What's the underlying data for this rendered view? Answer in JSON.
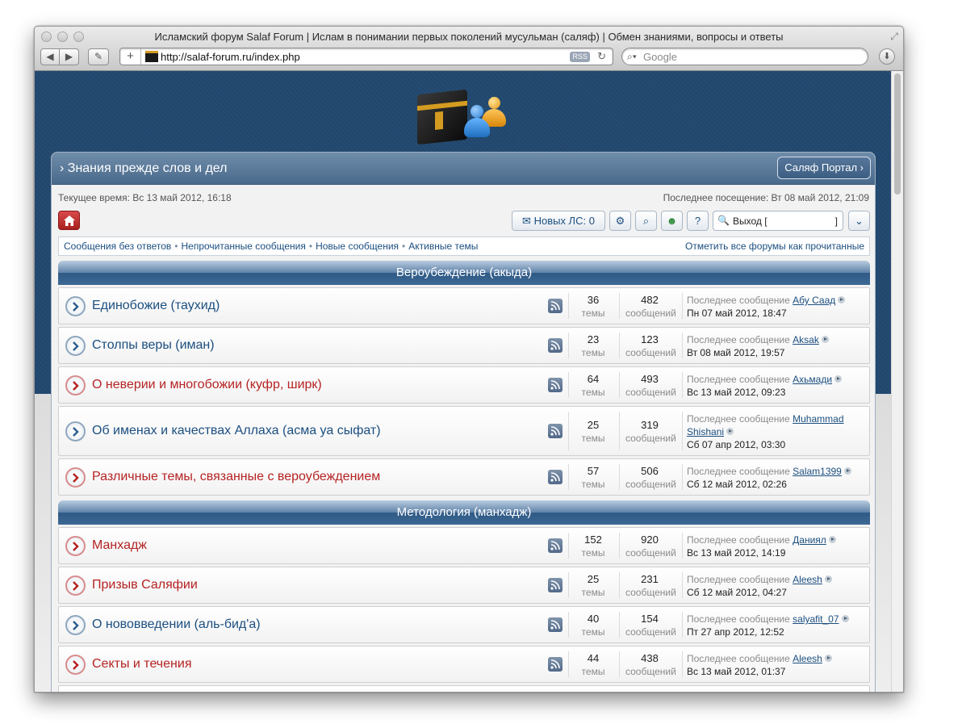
{
  "browser": {
    "title": "Исламский форум Salaf Forum | Ислам в понимании первых поколений мусульман (саляф) | Обмен знаниями, вопросы и ответы",
    "url": "http://salaf-forum.ru/index.php",
    "rss_label": "RSS",
    "search_placeholder": "Google"
  },
  "header": {
    "slogan": "Знания прежде слов и дел",
    "portal_button": "Саляф Портал"
  },
  "info": {
    "current_time": "Текущее время: Вс 13 май 2012, 16:18",
    "last_visit": "Последнее посещение: Вт 08 май 2012, 21:09"
  },
  "toolbar": {
    "new_pm": "Новых ЛС: 0",
    "logout": "Выход [",
    "logout_bracket": "]"
  },
  "quick_links": {
    "items": [
      "Сообщения без ответов",
      "Непрочитанные сообщения",
      "Новые сообщения",
      "Активные темы"
    ],
    "mark_read": "Отметить все форумы как прочитанные"
  },
  "stat_labels": {
    "topics": "темы",
    "posts": "сообщений",
    "last_post": "Последнее сообщение"
  },
  "categories": [
    {
      "title": "Вероубеждение (акыда)",
      "forums": [
        {
          "title": "Единобожие (таухид)",
          "topics": "36",
          "posts": "482",
          "author": "Абу Саад",
          "date": "Пн 07 май 2012, 18:47",
          "unread": false
        },
        {
          "title": "Столпы веры (иман)",
          "topics": "23",
          "posts": "123",
          "author": "Aksak",
          "date": "Вт 08 май 2012, 19:57",
          "unread": false
        },
        {
          "title": "О неверии и многобожии (куфр, ширк)",
          "topics": "64",
          "posts": "493",
          "author": "Ахьмади",
          "date": "Вс 13 май 2012, 09:23",
          "unread": true
        },
        {
          "title": "Об именах и качествах Аллаха (асма уа сыфат)",
          "topics": "25",
          "posts": "319",
          "author": "Muhammad",
          "author2": "Shishani",
          "date": "Сб 07 апр 2012, 03:30",
          "unread": false
        },
        {
          "title": "Различные темы, связанные с вероубеждением",
          "topics": "57",
          "posts": "506",
          "author": "Salam1399",
          "date": "Сб 12 май 2012, 02:26",
          "unread": true
        }
      ]
    },
    {
      "title": "Методология (манхадж)",
      "forums": [
        {
          "title": "Манхадж",
          "topics": "152",
          "posts": "920",
          "author": "Даниял",
          "date": "Вс 13 май 2012, 14:19",
          "unread": true
        },
        {
          "title": "Призыв Саляфии",
          "topics": "25",
          "posts": "231",
          "author": "Aleesh",
          "date": "Сб 12 май 2012, 04:27",
          "unread": true
        },
        {
          "title": "О нововведении (аль-бид'а)",
          "topics": "40",
          "posts": "154",
          "author": "salyafit_07",
          "date": "Пт 27 апр 2012, 12:52",
          "unread": false
        },
        {
          "title": "Секты и течения",
          "topics": "44",
          "posts": "438",
          "author": "Aleesh",
          "date": "Вс 13 май 2012, 01:37",
          "unread": true
        }
      ]
    }
  ]
}
